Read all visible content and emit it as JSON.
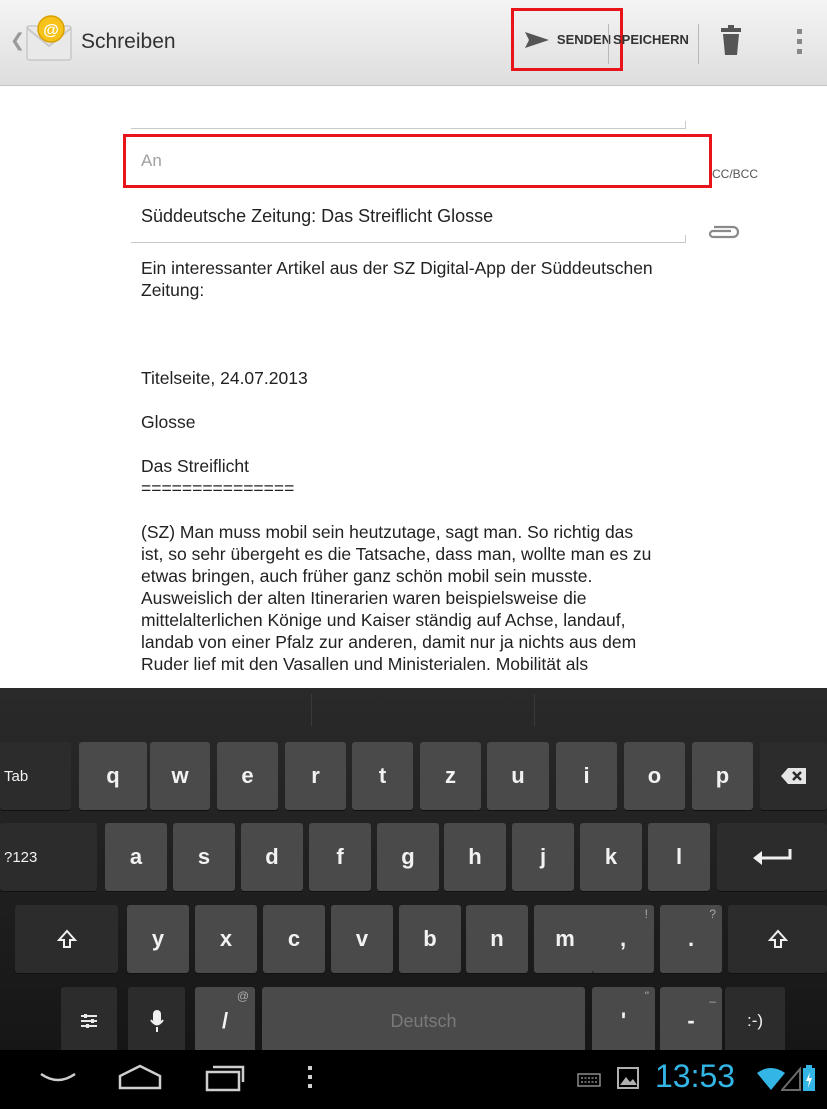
{
  "actionbar": {
    "title": "Schreiben",
    "send_label": "SENDEN",
    "save_label": "SPEICHERN",
    "icons": [
      "chevron-left-icon",
      "email-app-icon",
      "send-icon",
      "trash-icon",
      "overflow-menu-icon"
    ]
  },
  "compose": {
    "to_placeholder": "An",
    "to_value": "",
    "ccbcc_label": "CC/BCC",
    "subject": "Süddeutsche Zeitung: Das Streiflicht Glosse",
    "attach_icon": "paperclip-icon",
    "body": {
      "intro": [
        "Ein interessanter Artikel aus der SZ Digital-App der Süddeutschen",
        "Zeitung:"
      ],
      "section": "Titelseite, 24.07.2013",
      "kind": "Glosse",
      "headline": "Das Streiflicht",
      "underline": "===============",
      "paragraph": [
        "(SZ) Man muss mobil sein heutzutage, sagt man. So richtig das",
        "ist, so sehr übergeht es die Tatsache, dass man, wollte man es zu",
        "etwas bringen, auch früher ganz schön mobil sein musste.",
        "Ausweislich der alten Itinerarien waren beispielsweise die",
        "mittelalterlichen Könige und Kaiser ständig auf Achse, landauf,",
        "landab von einer Pfalz zur anderen, damit nur ja nichts aus dem",
        "Ruder lief mit den Vasallen und Ministerialen. Mobilität als"
      ]
    }
  },
  "keyboard": {
    "row1": [
      "Tab",
      "q",
      "w",
      "e",
      "r",
      "t",
      "z",
      "u",
      "i",
      "o",
      "p"
    ],
    "row2": [
      "?123",
      "a",
      "s",
      "d",
      "f",
      "g",
      "h",
      "j",
      "k",
      "l"
    ],
    "row3": [
      "y",
      "x",
      "c",
      "v",
      "b",
      "n",
      "m",
      ",",
      "."
    ],
    "row3_hints": {
      "comma": "!",
      "period": "?"
    },
    "slash": "/",
    "slash_hint": "@",
    "space_label": "Deutsch",
    "apostrophe": "'",
    "apostrophe_hint": "\"",
    "dash": "-",
    "dash_hint": "_",
    "smiley": ":-)",
    "icons": [
      "backspace-icon",
      "enter-icon",
      "shift-icon",
      "settings-icon",
      "microphone-icon"
    ]
  },
  "statusbar": {
    "clock": "13:53",
    "icons": [
      "keyboard-icon",
      "image-icon",
      "wifi-icon",
      "signal-icon",
      "battery-icon"
    ]
  },
  "navbar": {
    "icons": [
      "back-icon",
      "home-icon",
      "recents-icon",
      "menu-icon"
    ]
  },
  "colors": {
    "highlight": "#e8141a",
    "clock": "#33b5e5",
    "key": "#4a4a4a"
  }
}
